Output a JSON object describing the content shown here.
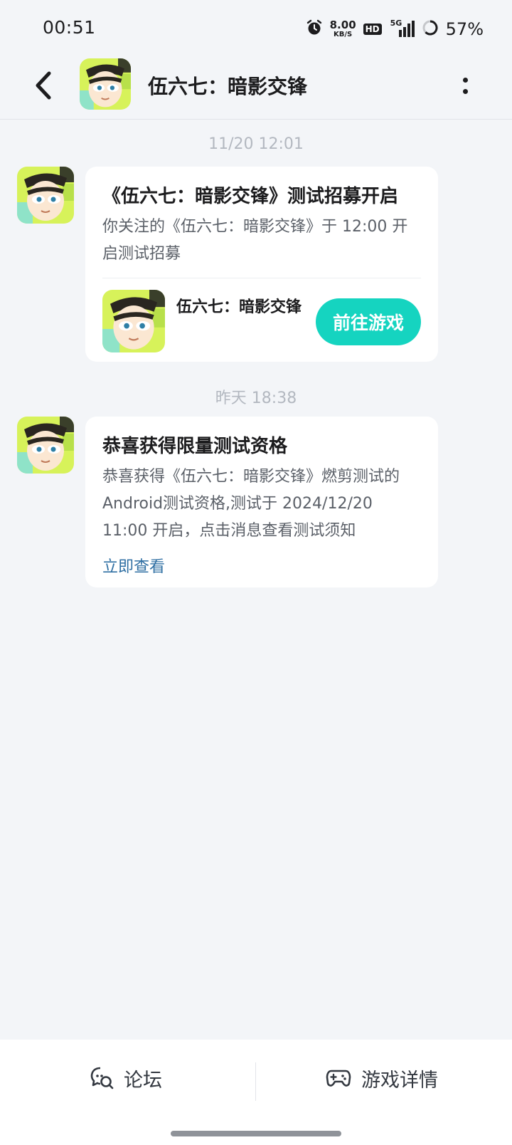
{
  "status_bar": {
    "time": "00:51",
    "net_speed_value": "8.00",
    "net_speed_unit": "KB/S",
    "hd_label": "HD",
    "network_label": "5G",
    "battery_percent": "57%",
    "icons": [
      "alarm-icon",
      "hd-icon",
      "signal-icon",
      "battery-ring-icon"
    ]
  },
  "header": {
    "title": "伍六七：暗影交锋",
    "back_icon": "chevron-left-icon",
    "more_icon": "more-vertical-icon"
  },
  "messages": [
    {
      "timestamp": "11/20  12:01",
      "title": "《伍六七：暗影交锋》测试招募开启",
      "body": "你关注的《伍六七：暗影交锋》于 12:00 开启测试招募",
      "game_name": "伍六七：暗影交锋",
      "action_label": "前往游戏"
    },
    {
      "timestamp": "昨天  18:38",
      "title": "恭喜获得限量测试资格",
      "body": "恭喜获得《伍六七：暗影交锋》燃剪测试的Android测试资格,测试于 2024/12/20 11:00 开启，点击消息查看测试须知",
      "link_label": "立即查看"
    }
  ],
  "bottom_bar": {
    "forum_label": "论坛",
    "details_label": "游戏详情"
  },
  "colors": {
    "accent": "#15d4c0",
    "link": "#2f6fa3",
    "background": "#f3f5f8",
    "card": "#ffffff"
  }
}
